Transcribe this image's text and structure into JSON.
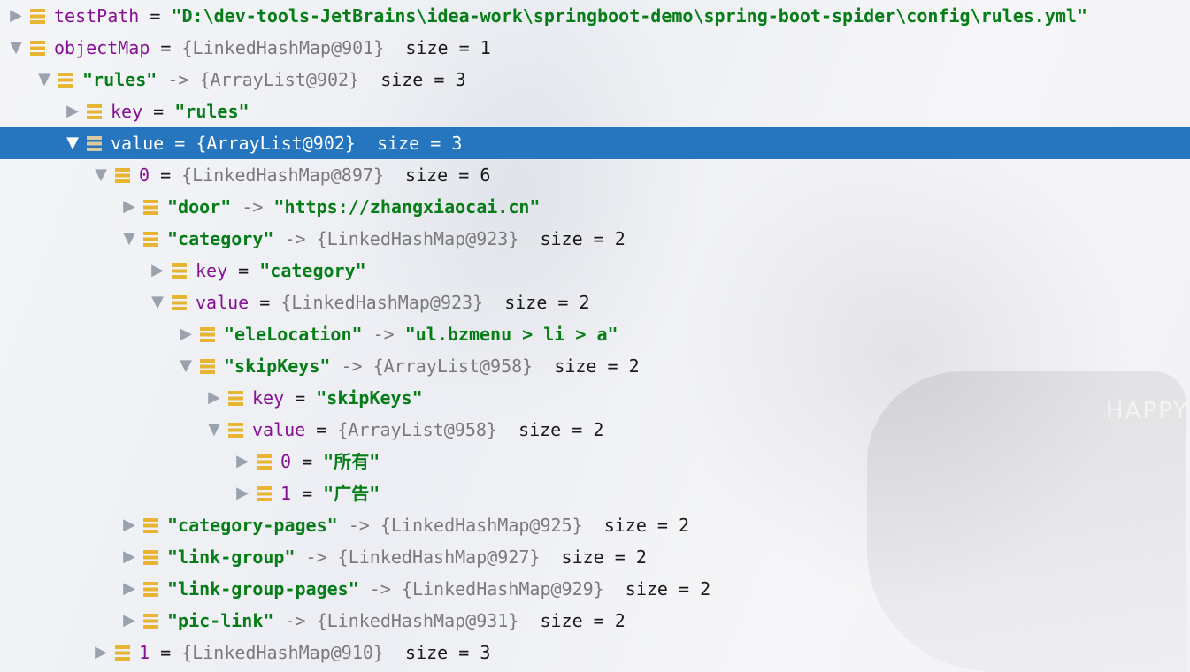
{
  "app": "IntelliJ IDEA debugger variables view",
  "colors": {
    "selection": "#2675bf",
    "string": "#067d17",
    "field": "#871094",
    "ref": "#7a7a7a",
    "field_icon": "#e8b532"
  },
  "icons": {
    "expanded": "▼",
    "collapsed": "▶",
    "field": "field-icon"
  },
  "size_label": "size = ",
  "rows": [
    {
      "state": "collapsed",
      "name": "testPath",
      "op": " = ",
      "value": "\"D:\\dev-tools-JetBrains\\idea-work\\springboot-demo\\spring-boot-spider\\config\\rules.yml\""
    },
    {
      "state": "expanded",
      "name": "objectMap",
      "op": " = ",
      "ref": "{LinkedHashMap@901}",
      "size": "size = 1"
    },
    {
      "state": "expanded",
      "name": "\"rules\"",
      "op": " -> ",
      "ref": "{ArrayList@902}",
      "size": "size = 3"
    },
    {
      "state": "collapsed",
      "name": "key",
      "op": " = ",
      "value": "\"rules\""
    },
    {
      "state": "expanded",
      "selected": true,
      "name": "value",
      "op": " = ",
      "ref": "{ArrayList@902}",
      "size": "size = 3"
    },
    {
      "state": "expanded",
      "name": "0",
      "op": " = ",
      "ref": "{LinkedHashMap@897}",
      "size": "size = 6"
    },
    {
      "state": "collapsed",
      "name": "\"door\"",
      "op": " -> ",
      "value": "\"https://zhangxiaocai.cn\""
    },
    {
      "state": "expanded",
      "name": "\"category\"",
      "op": " -> ",
      "ref": "{LinkedHashMap@923}",
      "size": "size = 2"
    },
    {
      "state": "collapsed",
      "name": "key",
      "op": " = ",
      "value": "\"category\""
    },
    {
      "state": "expanded",
      "name": "value",
      "op": " = ",
      "ref": "{LinkedHashMap@923}",
      "size": "size = 2"
    },
    {
      "state": "collapsed",
      "name": "\"eleLocation\"",
      "op": " -> ",
      "value": "\"ul.bzmenu > li > a\""
    },
    {
      "state": "expanded",
      "name": "\"skipKeys\"",
      "op": " -> ",
      "ref": "{ArrayList@958}",
      "size": "size = 2"
    },
    {
      "state": "collapsed",
      "name": "key",
      "op": " = ",
      "value": "\"skipKeys\""
    },
    {
      "state": "expanded",
      "name": "value",
      "op": " = ",
      "ref": "{ArrayList@958}",
      "size": "size = 2"
    },
    {
      "state": "collapsed",
      "name": "0",
      "op": " = ",
      "value": "\"所有\""
    },
    {
      "state": "collapsed",
      "name": "1",
      "op": " = ",
      "value": "\"广告\""
    },
    {
      "state": "collapsed",
      "name": "\"category-pages\"",
      "op": " -> ",
      "ref": "{LinkedHashMap@925}",
      "size": "size = 2"
    },
    {
      "state": "collapsed",
      "name": "\"link-group\"",
      "op": " -> ",
      "ref": "{LinkedHashMap@927}",
      "size": "size = 2"
    },
    {
      "state": "collapsed",
      "name": "\"link-group-pages\"",
      "op": " -> ",
      "ref": "{LinkedHashMap@929}",
      "size": "size = 2"
    },
    {
      "state": "collapsed",
      "name": "\"pic-link\"",
      "op": " -> ",
      "ref": "{LinkedHashMap@931}",
      "size": "size = 2"
    },
    {
      "state": "collapsed",
      "name": "1",
      "op": " = ",
      "ref": "{LinkedHashMap@910}",
      "size": "size = 3"
    }
  ]
}
